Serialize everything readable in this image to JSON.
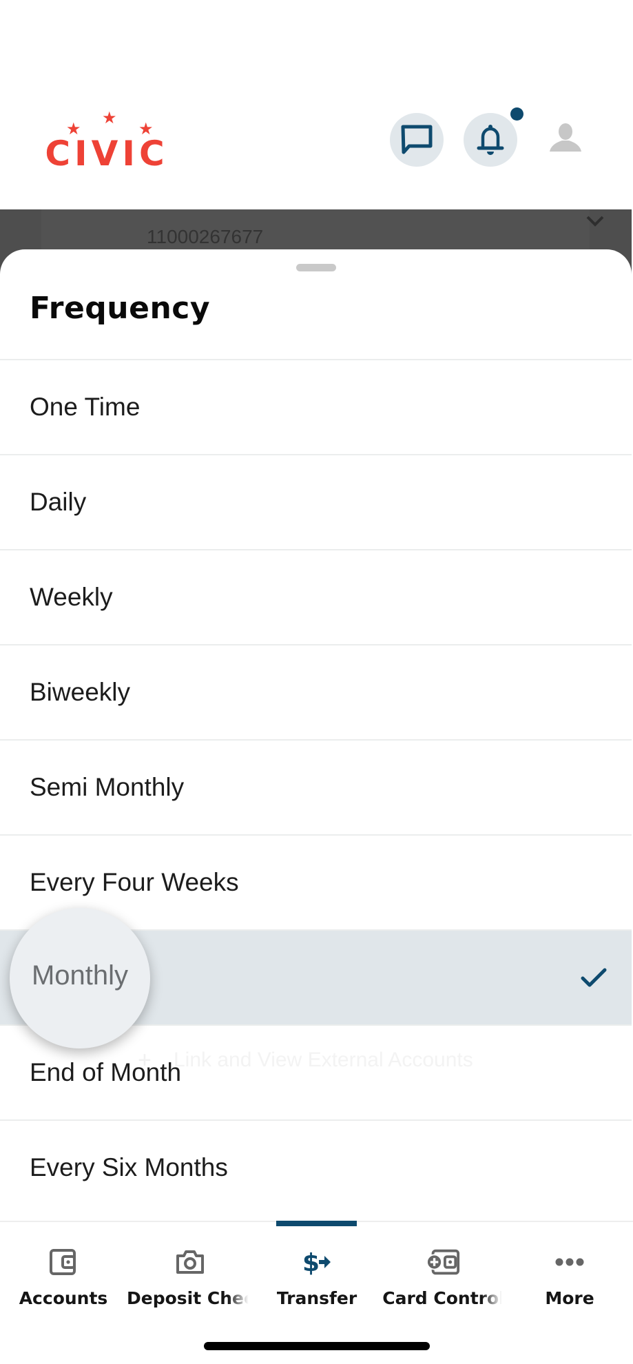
{
  "header": {
    "logo_text": "CIVIC",
    "icons": {
      "chat": "chat-bubble-icon",
      "notifications": "bell-icon",
      "profile": "user-profile-icon"
    },
    "has_unread_notifications": true
  },
  "background_page": {
    "account_number": "11000267677",
    "ghost_link_text": "Link and View External Accounts",
    "ghost_link_icon": "plus-icon"
  },
  "sheet": {
    "title": "Frequency",
    "options": [
      {
        "label": "One Time",
        "selected": false
      },
      {
        "label": "Daily",
        "selected": false
      },
      {
        "label": "Weekly",
        "selected": false
      },
      {
        "label": "Biweekly",
        "selected": false
      },
      {
        "label": "Semi Monthly",
        "selected": false
      },
      {
        "label": "Every Four Weeks",
        "selected": false
      },
      {
        "label": "Monthly",
        "selected": true
      },
      {
        "label": "End of Month",
        "selected": false
      },
      {
        "label": "Every Six Months",
        "selected": false
      }
    ],
    "magnifier_text": "Monthly"
  },
  "tabbar": {
    "active": "Transfer",
    "tabs": [
      {
        "label": "Accounts",
        "icon": "wallet-icon"
      },
      {
        "label": "Deposit Chec",
        "icon": "camera-icon"
      },
      {
        "label": "Transfer",
        "icon": "dollar-transfer-icon"
      },
      {
        "label": "Card Control",
        "icon": "card-control-icon"
      },
      {
        "label": "More",
        "icon": "more-dots-icon"
      }
    ]
  },
  "colors": {
    "brand_red": "#ee4236",
    "accent_navy": "#0e4a6e",
    "selected_row_bg": "#e0e6ea",
    "icon_circle_bg": "#e1e7eb"
  }
}
